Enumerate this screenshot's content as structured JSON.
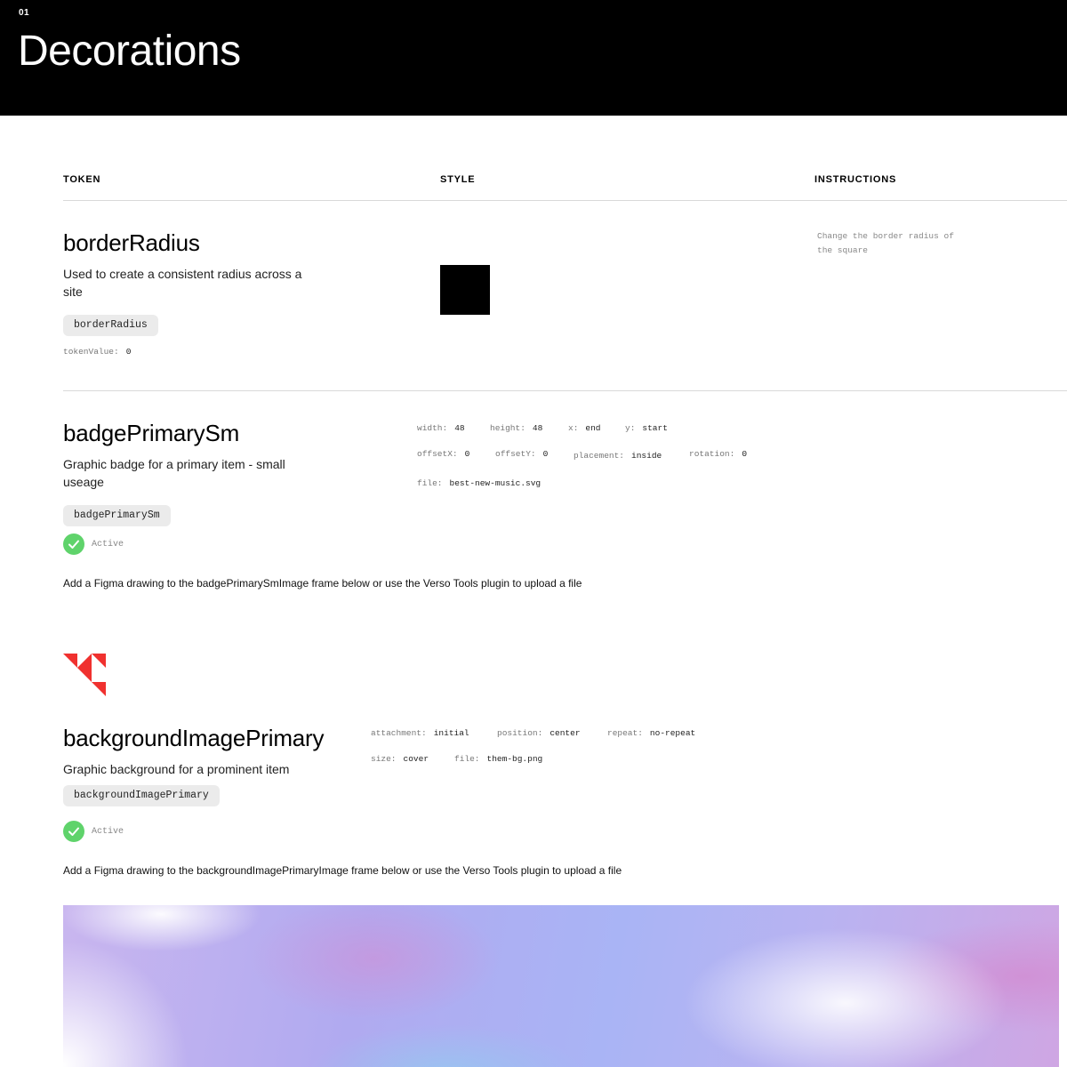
{
  "header": {
    "number": "01",
    "title": "Decorations"
  },
  "columns": {
    "token": "TOKEN",
    "style": "STYLE",
    "instructions": "INSTRUCTIONS"
  },
  "border_radius": {
    "name": "borderRadius",
    "description": "Used to create a consistent radius across a site",
    "chip": "borderRadius",
    "token_value_label": "tokenValue:",
    "token_value": "0",
    "instructions": "Change the border radius of the square"
  },
  "badge_primary_sm": {
    "name": "badgePrimarySm",
    "description": "Graphic badge for a primary item - small useage",
    "chip": "badgePrimarySm",
    "status": "Active",
    "props": {
      "width_label": "width:",
      "width": "48",
      "height_label": "height:",
      "height": "48",
      "x_label": "x:",
      "x": "end",
      "y_label": "y:",
      "y": "start",
      "offsetx_label": "offsetX:",
      "offsetx": "0",
      "offsety_label": "offsetY:",
      "offsety": "0",
      "placement_label": "placement:",
      "placement": "inside",
      "rotation_label": "rotation:",
      "rotation": "0",
      "file_label": "file:",
      "file": "best-new-music.svg"
    },
    "instruction_text": "Add a Figma drawing to the badgePrimarySmImage frame below or use the Verso Tools plugin to upload a file",
    "icon_color": "#f0312f"
  },
  "background_image_primary": {
    "name": "backgroundImagePrimary",
    "description": "Graphic background for a prominent item",
    "chip": "backgroundImagePrimary",
    "status": "Active",
    "props": {
      "attachment_label": "attachment:",
      "attachment": "initial",
      "position_label": "position:",
      "position": "center",
      "repeat_label": "repeat:",
      "repeat": "no-repeat",
      "size_label": "size:",
      "size": "cover",
      "file_label": "file:",
      "file": "them-bg.png"
    },
    "instruction_text": "Add a Figma drawing to the backgroundImagePrimaryImage frame below or use the Verso Tools plugin to upload a file"
  },
  "colors": {
    "active_green": "#5fd36b",
    "badge_red": "#f0312f"
  }
}
